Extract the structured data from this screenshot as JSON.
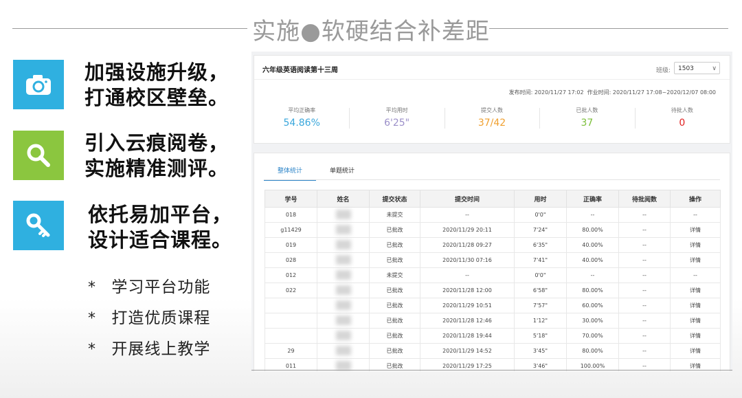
{
  "slide": {
    "title": "实施●软硬结合补差距",
    "features": [
      {
        "icon": "camera-icon",
        "color": "#2fb0e0",
        "line1": "加强设施升级，",
        "line2": "打通校区壁垒。"
      },
      {
        "icon": "magnifier-icon",
        "color": "#8bc63f",
        "line1": "引入云痕阅卷，",
        "line2": "实施精准测评。"
      },
      {
        "icon": "key-icon",
        "color": "#2fb0e0",
        "line1": "依托易加平台，",
        "line2": "设计适合课程。"
      }
    ],
    "bullets": [
      "学习平台功能",
      "打造优质课程",
      "开展线上教学"
    ],
    "bullet_mark": "*"
  },
  "app": {
    "homework_title": "六年级英语阅读第十三周",
    "class_label": "班级:",
    "class_value": "1503",
    "publish_time": "发布时间: 2020/11/27 17:02",
    "work_time": "作业时间: 2020/11/27 17:08~2020/12/07 08:00",
    "stats": [
      {
        "label": "平均正确率",
        "value": "54.86%",
        "color": "#3aa7dc"
      },
      {
        "label": "平均用时",
        "value": "6'25\"",
        "color": "#9b8fc9"
      },
      {
        "label": "提交人数",
        "value": "37/42",
        "color": "#f0a030"
      },
      {
        "label": "已批人数",
        "value": "37",
        "color": "#7cbf3a"
      },
      {
        "label": "待批人数",
        "value": "0",
        "color": "#e02020"
      }
    ],
    "tabs": [
      "整体统计",
      "单题统计"
    ],
    "columns": [
      "学号",
      "姓名",
      "提交状态",
      "提交时间",
      "用时",
      "正确率",
      "待批阅数",
      "操作"
    ],
    "rows": [
      {
        "id": "018",
        "status": "未提交",
        "submitted": false,
        "time": "--",
        "duration": "0'0\"",
        "accuracy": "--",
        "pending": "--",
        "action": "--"
      },
      {
        "id": "g11429",
        "status": "已批改",
        "submitted": true,
        "time": "2020/11/29 20:11",
        "duration": "7'24\"",
        "accuracy": "80.00%",
        "pending": "--",
        "action": "详情"
      },
      {
        "id": "019",
        "status": "已批改",
        "submitted": true,
        "time": "2020/11/28 09:27",
        "duration": "6'35\"",
        "accuracy": "40.00%",
        "pending": "--",
        "action": "详情"
      },
      {
        "id": "028",
        "status": "已批改",
        "submitted": true,
        "time": "2020/11/30 07:16",
        "duration": "7'41\"",
        "accuracy": "40.00%",
        "pending": "--",
        "action": "详情"
      },
      {
        "id": "012",
        "status": "未提交",
        "submitted": false,
        "time": "--",
        "duration": "0'0\"",
        "accuracy": "--",
        "pending": "--",
        "action": "--"
      },
      {
        "id": "022",
        "status": "已批改",
        "submitted": true,
        "time": "2020/11/28 12:00",
        "duration": "6'58\"",
        "accuracy": "80.00%",
        "pending": "--",
        "action": "详情"
      },
      {
        "id": "",
        "status": "已批改",
        "submitted": true,
        "time": "2020/11/29 10:51",
        "duration": "7'57\"",
        "accuracy": "60.00%",
        "pending": "--",
        "action": "详情"
      },
      {
        "id": "",
        "status": "已批改",
        "submitted": true,
        "time": "2020/11/28 12:46",
        "duration": "1'12\"",
        "accuracy": "30.00%",
        "pending": "--",
        "action": "详情"
      },
      {
        "id": "",
        "status": "已批改",
        "submitted": true,
        "time": "2020/11/28 19:44",
        "duration": "5'18\"",
        "accuracy": "70.00%",
        "pending": "--",
        "action": "详情"
      },
      {
        "id": "29",
        "status": "已批改",
        "submitted": true,
        "time": "2020/11/29 14:52",
        "duration": "3'45\"",
        "accuracy": "80.00%",
        "pending": "--",
        "action": "详情"
      },
      {
        "id": "011",
        "status": "已批改",
        "submitted": true,
        "time": "2020/11/29 17:25",
        "duration": "3'46\"",
        "accuracy": "100.00%",
        "pending": "--",
        "action": "详情"
      }
    ]
  }
}
